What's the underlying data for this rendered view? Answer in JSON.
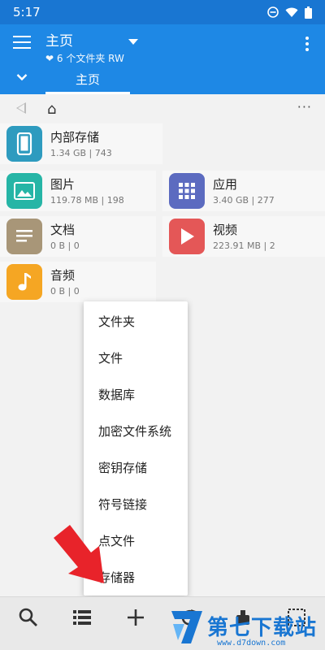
{
  "status_bar": {
    "time": "5:17"
  },
  "app_bar": {
    "title": "主页",
    "subtitle": "❤ 6 个文件夹 RW"
  },
  "tabs": [
    {
      "label": "主页"
    }
  ],
  "path_bar": {
    "more": "···"
  },
  "tiles": [
    {
      "name": "内部存储",
      "meta": "1.34 GB | 743",
      "color": "#2e9bbf",
      "icon": "phone-icon"
    },
    {
      "name": "图片",
      "meta": "119.78 MB | 198",
      "color": "#26b5a6",
      "icon": "image-icon"
    },
    {
      "name": "应用",
      "meta": "3.40 GB | 277",
      "color": "#5c6bc0",
      "icon": "apps-grid-icon"
    },
    {
      "name": "文档",
      "meta": "0 B | 0",
      "color": "#a89678",
      "icon": "document-icon"
    },
    {
      "name": "视频",
      "meta": "223.91 MB | 2",
      "color": "#e45757",
      "icon": "play-icon"
    },
    {
      "name": "音频",
      "meta": "0 B | 0",
      "color": "#f5a623",
      "icon": "music-note-icon"
    }
  ],
  "popup_menu": {
    "items": [
      {
        "label": "文件夹"
      },
      {
        "label": "文件"
      },
      {
        "label": "数据库"
      },
      {
        "label": "加密文件系统"
      },
      {
        "label": "密钥存储"
      },
      {
        "label": "符号链接"
      },
      {
        "label": "点文件"
      },
      {
        "label": "存储器"
      }
    ]
  },
  "watermark": {
    "text": "第七下载站",
    "url": "www.d7down.com"
  },
  "colors": {
    "primary": "#1e88e5",
    "status": "#1976d2",
    "arrow": "#e8232a"
  }
}
